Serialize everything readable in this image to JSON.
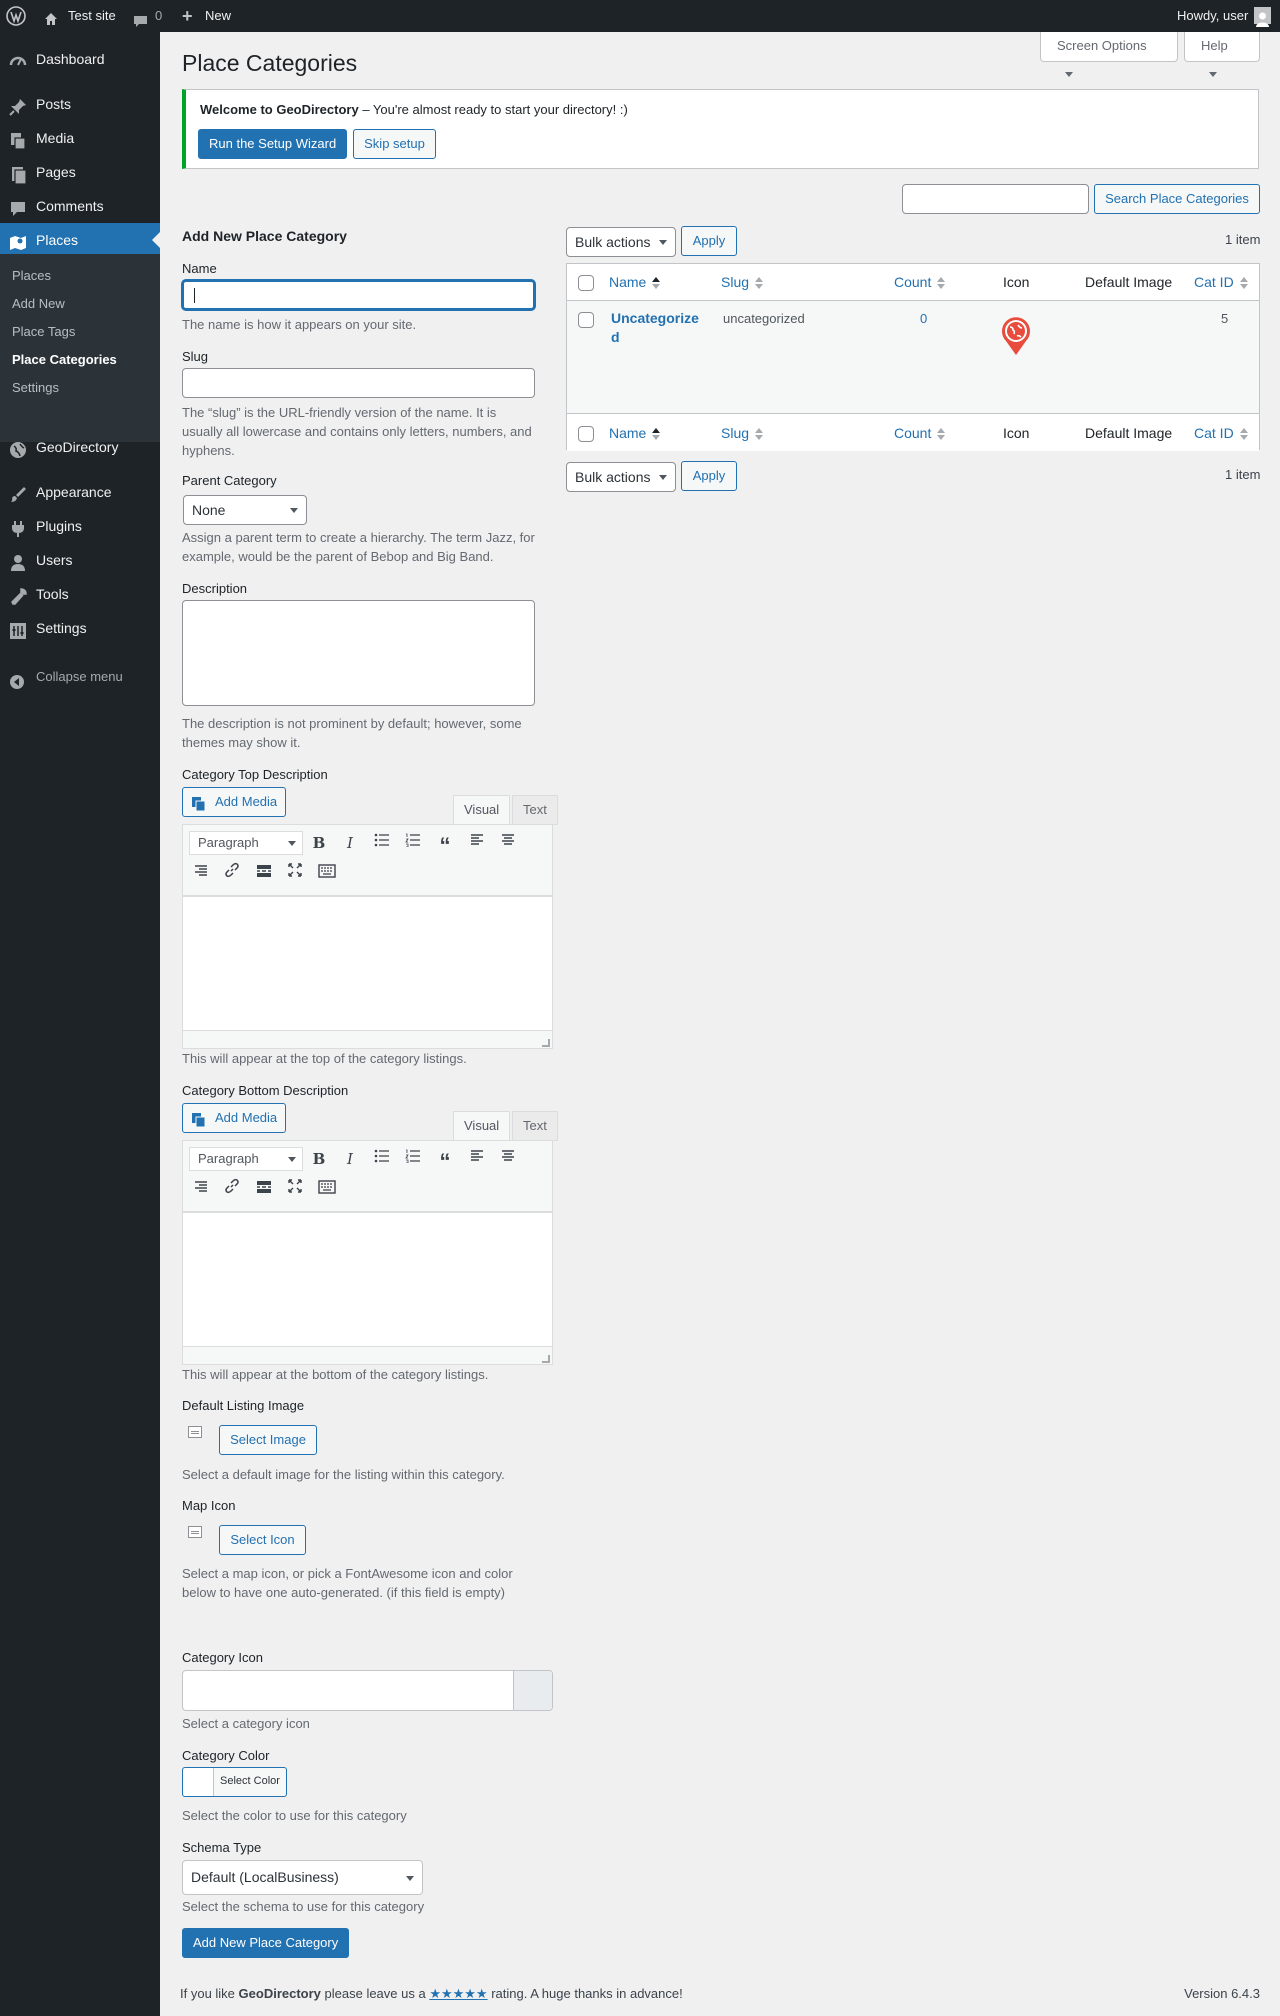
{
  "adminbar": {
    "site_name": "Test site",
    "comments_count": "0",
    "new_label": "New",
    "howdy": "Howdy, user"
  },
  "sidebar": {
    "items": [
      {
        "label": "Dashboard",
        "icon": "dashboard-icon"
      },
      {
        "label": "Posts",
        "icon": "pin-icon"
      },
      {
        "label": "Media",
        "icon": "media-icon"
      },
      {
        "label": "Pages",
        "icon": "pages-icon"
      },
      {
        "label": "Comments",
        "icon": "comment-icon"
      },
      {
        "label": "Places",
        "icon": "map-icon"
      },
      {
        "label": "GeoDirectory",
        "icon": "globe-icon"
      },
      {
        "label": "Appearance",
        "icon": "brush-icon"
      },
      {
        "label": "Plugins",
        "icon": "plug-icon"
      },
      {
        "label": "Users",
        "icon": "user-icon"
      },
      {
        "label": "Tools",
        "icon": "wrench-icon"
      },
      {
        "label": "Settings",
        "icon": "settings-icon"
      }
    ],
    "submenu": [
      "Places",
      "Add New",
      "Place Tags",
      "Place Categories",
      "Settings"
    ],
    "collapse_label": "Collapse menu"
  },
  "header": {
    "screen_options": "Screen Options",
    "help": "Help",
    "title": "Place Categories"
  },
  "notice": {
    "strong": "Welcome to GeoDirectory",
    "text": " – You're almost ready to start your directory! :)",
    "primary_button": "Run the Setup Wizard",
    "secondary_button": "Skip setup"
  },
  "search": {
    "value": "",
    "button": "Search Place Categories"
  },
  "form": {
    "title": "Add New Place Category",
    "name_label": "Name",
    "name_value": "",
    "name_desc": "The name is how it appears on your site.",
    "slug_label": "Slug",
    "slug_desc": "The “slug” is the URL-friendly version of the name. It is usually all lowercase and contains only letters, numbers, and hyphens.",
    "parent_label": "Parent Category",
    "parent_value": "None",
    "parent_desc": "Assign a parent term to create a hierarchy. The term Jazz, for example, would be the parent of Bebop and Big Band.",
    "description_label": "Description",
    "description_desc": "The description is not prominent by default; however, some themes may show it.",
    "top_desc_label": "Category Top Description",
    "top_desc_help": "This will appear at the top of the category listings.",
    "bottom_desc_label": "Category Bottom Description",
    "bottom_desc_help": "This will appear at the bottom of the category listings.",
    "editor": {
      "add_media": "Add Media",
      "tab_visual": "Visual",
      "tab_text": "Text",
      "format": "Paragraph"
    },
    "default_image_label": "Default Listing Image",
    "select_image": "Select Image",
    "default_image_desc": "Select a default image for the listing within this category.",
    "map_icon_label": "Map Icon",
    "select_icon": "Select Icon",
    "map_icon_desc": "Select a map icon, or pick a FontAwesome icon and color below to have one auto-generated. (if this field is empty)",
    "cat_icon_label": "Category Icon",
    "cat_icon_desc": "Select a category icon",
    "cat_color_label": "Category Color",
    "select_color": "Select Color",
    "cat_color_desc": "Select the color to use for this category",
    "schema_label": "Schema Type",
    "schema_value": "Default (LocalBusiness)",
    "schema_desc": "Select the schema to use for this category",
    "submit": "Add New Place Category"
  },
  "table": {
    "bulk_actions": "Bulk actions",
    "apply": "Apply",
    "count_text": "1 item",
    "columns": [
      "Name",
      "Slug",
      "Count",
      "Icon",
      "Default Image",
      "Cat ID"
    ],
    "rows": [
      {
        "name_line1": "Uncategorize",
        "name_line2": "d",
        "slug": "uncategorized",
        "count": "0",
        "cat_id": "5",
        "icon": "map-pin-globe-icon",
        "icon_color": "#e74c3c"
      }
    ]
  },
  "footer": {
    "prefix": "If you like ",
    "brand": "GeoDirectory",
    "middle": " please leave us a ",
    "stars": "★★★★★",
    "suffix": " rating. A huge thanks in advance!",
    "version": "Version 6.4.3"
  },
  "colors": {
    "accent": "#2271b1",
    "notice_border": "#00a32a",
    "admin_bg": "#1d2327"
  }
}
